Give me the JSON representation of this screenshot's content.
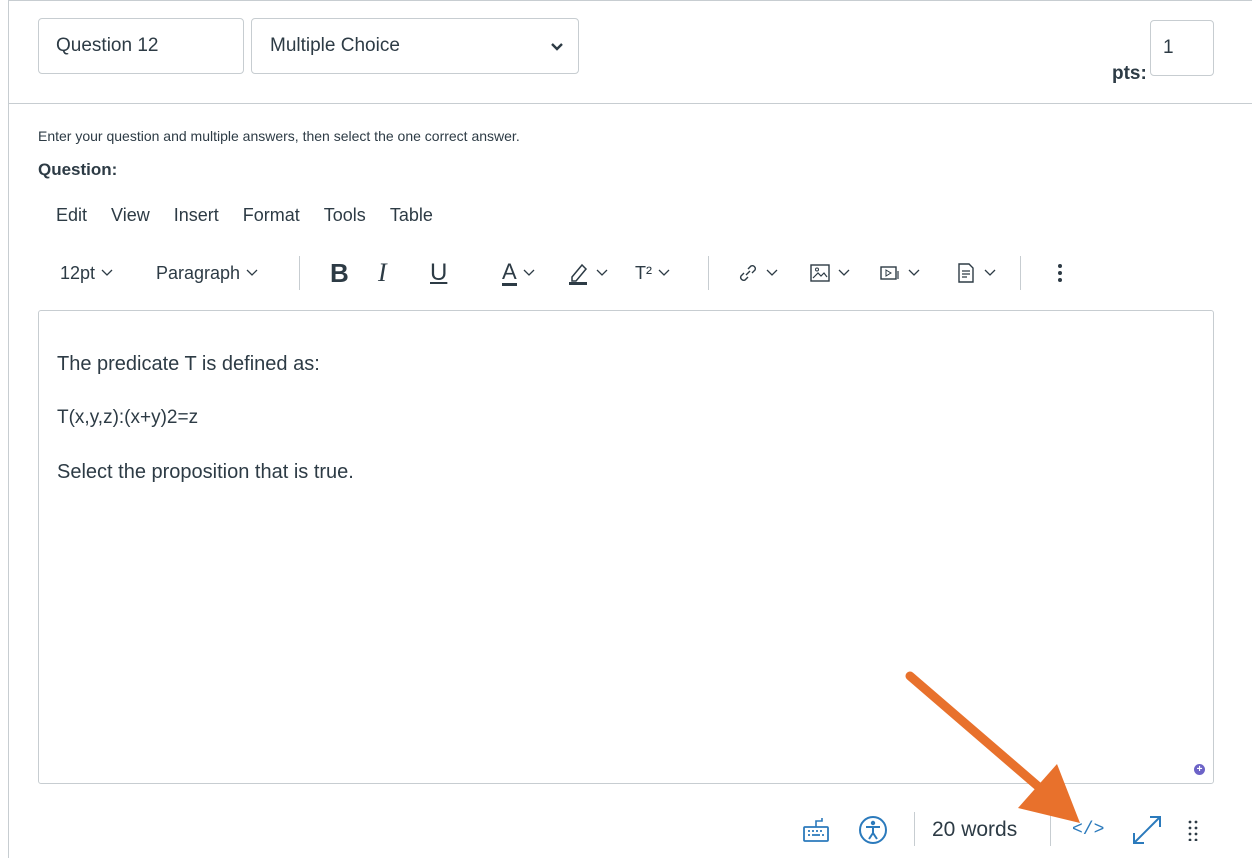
{
  "header": {
    "question_name": "Question 12",
    "question_type": "Multiple Choice",
    "points_label": "pts:",
    "points_value": "1"
  },
  "instructions": "Enter your question and multiple answers, then select the one correct answer.",
  "question_label": "Question:",
  "menubar": [
    "Edit",
    "View",
    "Insert",
    "Format",
    "Tools",
    "Table"
  ],
  "toolbar": {
    "font_size": "12pt",
    "block_format": "Paragraph",
    "bold": "B",
    "italic": "I",
    "underline": "U",
    "text_color": "A",
    "superscript": "T²"
  },
  "editor": {
    "lines": [
      "The predicate T is defined as:",
      "T(x,y,z):(x+y)2=z",
      "Select the proposition that is true."
    ]
  },
  "status": {
    "word_count": "20 words",
    "html_editor_label": "</>"
  },
  "colors": {
    "accent_blue": "#2b7abc",
    "annotation_arrow": "#e8712c",
    "border": "#c7cdd1"
  }
}
